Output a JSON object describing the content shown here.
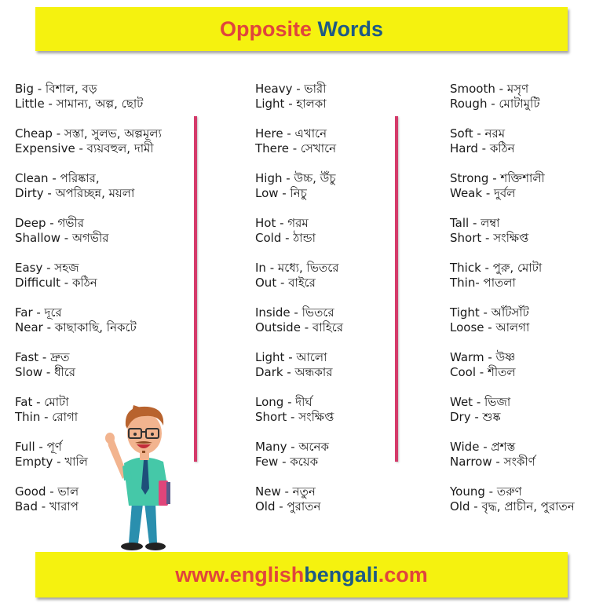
{
  "header": {
    "title_part1": "Opposite",
    "title_part2": "Words",
    "colors": {
      "banner_bg": "#f5f20f",
      "red": "#e0453c",
      "blue": "#1e5a84",
      "divider": "#d43a6a"
    }
  },
  "columns": [
    {
      "pairs": [
        {
          "a": "Big   - বিশাল, বড়",
          "b": "Little - সামান্য, অল্প, ছোট"
        },
        {
          "a": "Cheap - সস্তা, সুলভ, অল্পমূল্য",
          "b": "Expensive - ব্যয়বহুল, দামী"
        },
        {
          "a": "Clean - পরিষ্কার,",
          "b": "Dirty - অপরিচ্ছন্ন, ময়লা"
        },
        {
          "a": "Deep - গভীর",
          "b": "Shallow - অগভীর"
        },
        {
          "a": "Easy - সহজ",
          "b": "Difficult - কঠিন"
        },
        {
          "a": "Far - দূরে",
          "b": "Near - কাছাকাছি, নিকটে"
        },
        {
          "a": "Fast - দ্রুত",
          "b": "Slow - ধীরে"
        },
        {
          "a": "Fat - মোটা",
          "b": "Thin - রোগা"
        },
        {
          "a": "Full - পূর্ণ",
          "b": "Empty - খালি"
        },
        {
          "a": "Good - ভাল",
          "b": "Bad - খারাপ"
        }
      ]
    },
    {
      "pairs": [
        {
          "a": "Heavy - ভারী",
          "b": "Light - হালকা"
        },
        {
          "a": "Here - এখানে",
          "b": "There - সেখানে"
        },
        {
          "a": "High - উচ্চ, উঁচু",
          "b": "Low - নিচু"
        },
        {
          "a": "Hot - গরম",
          "b": "Cold - ঠান্ডা"
        },
        {
          "a": "In - মধ্যে, ভিতরে",
          "b": "Out - বাইরে"
        },
        {
          "a": "Inside - ভিতরে",
          "b": "Outside - বাহিরে"
        },
        {
          "a": "Light - আলো",
          "b": "Dark - অন্ধকার"
        },
        {
          "a": "Long - দীর্ঘ",
          "b": "Short - সংক্ষিপ্ত"
        },
        {
          "a": "Many - অনেক",
          "b": "Few - কয়েক"
        },
        {
          "a": "New - নতুন",
          "b": "Old - পুরাতন"
        }
      ]
    },
    {
      "pairs": [
        {
          "a": "Smooth - মসৃণ",
          "b": "Rough - মোটামুটি"
        },
        {
          "a": "Soft - নরম",
          "b": "Hard - কঠিন"
        },
        {
          "a": "Strong - শক্তিশালী",
          "b": "Weak - দুর্বল"
        },
        {
          "a": "Tall - লম্বা",
          "b": "Short - সংক্ষিপ্ত"
        },
        {
          "a": "Thick - পুরু, মোটা",
          "b": "Thin- পাতলা"
        },
        {
          "a": "Tight  - আঁটসাঁট",
          "b": "Loose - আলগা"
        },
        {
          "a": "Warm - উষ্ণ",
          "b": "Cool - শীতল"
        },
        {
          "a": "Wet - ভিজা",
          "b": "Dry - শুষ্ক"
        },
        {
          "a": "Wide - প্রশস্ত",
          "b": "Narrow - সংকীর্ণ"
        },
        {
          "a": "Young - তরুণ",
          "b": "Old - বৃদ্ধ, প্রাচীন, পুরাতন"
        }
      ]
    }
  ],
  "footer": {
    "url_part1": "www.english",
    "url_part2": "bengali",
    "url_part3": ".com"
  },
  "illustration": {
    "icon": "teacher-character-thumbs-up"
  }
}
